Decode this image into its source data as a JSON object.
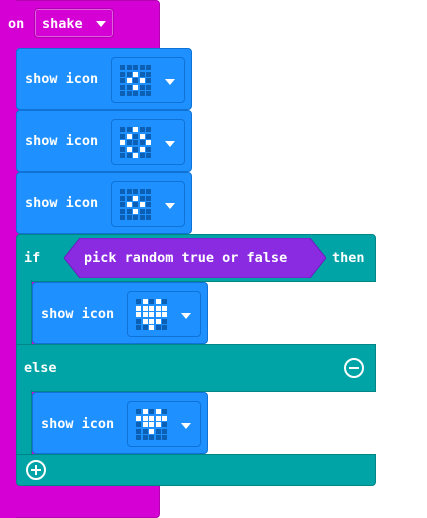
{
  "event_block": {
    "keyword": "on",
    "event": "shake",
    "color": "#d400d4"
  },
  "blocks": [
    {
      "label": "show icon",
      "icon": [
        [
          0,
          0,
          0,
          0,
          0
        ],
        [
          0,
          0,
          1,
          0,
          0
        ],
        [
          0,
          1,
          0,
          1,
          0
        ],
        [
          0,
          0,
          1,
          0,
          0
        ],
        [
          0,
          0,
          0,
          0,
          0
        ]
      ]
    },
    {
      "label": "show icon",
      "icon": [
        [
          0,
          0,
          1,
          0,
          0
        ],
        [
          0,
          1,
          0,
          1,
          0
        ],
        [
          1,
          0,
          0,
          0,
          1
        ],
        [
          0,
          1,
          0,
          1,
          0
        ],
        [
          0,
          0,
          1,
          0,
          0
        ]
      ]
    },
    {
      "label": "show icon",
      "icon": [
        [
          0,
          0,
          0,
          0,
          0
        ],
        [
          0,
          0,
          1,
          0,
          0
        ],
        [
          0,
          1,
          0,
          1,
          0
        ],
        [
          0,
          0,
          1,
          0,
          0
        ],
        [
          0,
          0,
          0,
          0,
          0
        ]
      ]
    }
  ],
  "if_block": {
    "if_label": "if",
    "condition": "pick random true or false",
    "then_label": "then",
    "then_block": {
      "label": "show icon",
      "icon": [
        [
          0,
          1,
          0,
          1,
          0
        ],
        [
          1,
          1,
          1,
          1,
          1
        ],
        [
          1,
          1,
          1,
          1,
          1
        ],
        [
          0,
          1,
          1,
          1,
          0
        ],
        [
          0,
          0,
          1,
          0,
          0
        ]
      ]
    },
    "else_label": "else",
    "else_block": {
      "label": "show icon",
      "icon": [
        [
          0,
          1,
          0,
          1,
          0
        ],
        [
          1,
          1,
          1,
          1,
          1
        ],
        [
          0,
          1,
          1,
          1,
          0
        ],
        [
          0,
          0,
          1,
          0,
          0
        ],
        [
          0,
          0,
          0,
          0,
          0
        ]
      ]
    },
    "remove_icon": "minus-circle-icon",
    "add_icon": "plus-circle-icon"
  },
  "colors": {
    "event": "#d400d4",
    "basic": "#1e90ff",
    "logic": "#00a4a6",
    "boolean": "#8a2be2"
  }
}
